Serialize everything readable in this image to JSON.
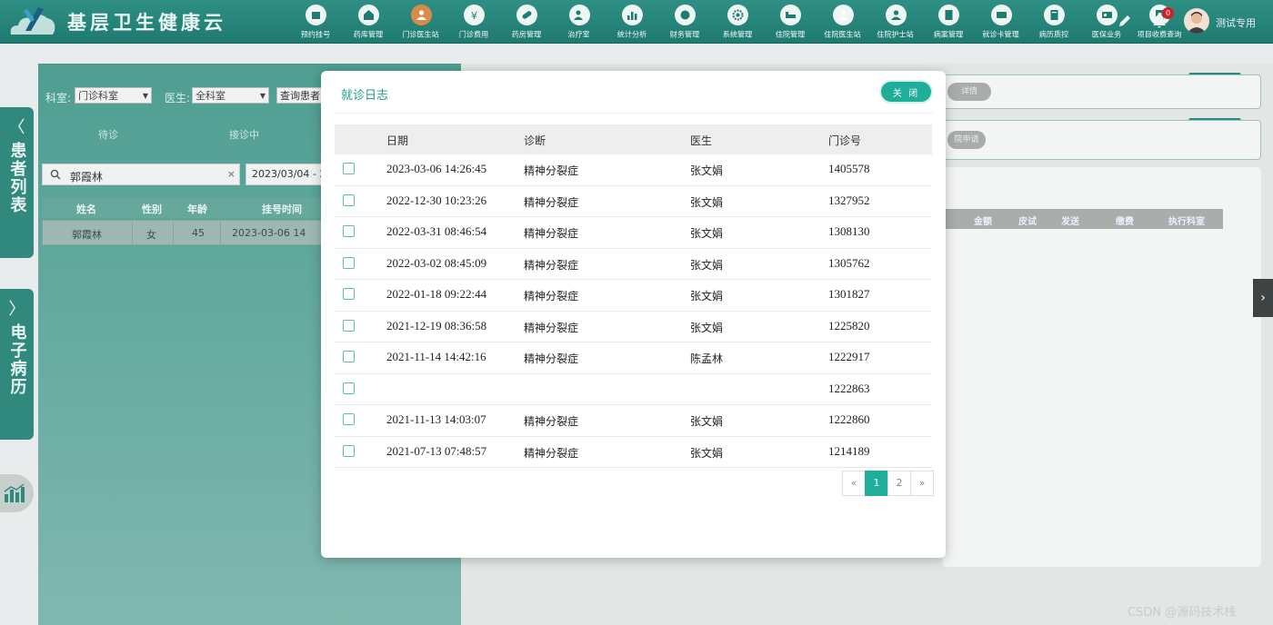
{
  "app": {
    "title": "基层卫生健康云"
  },
  "nav": [
    {
      "label": "预约挂号",
      "icon": "calendar-icon"
    },
    {
      "label": "药库管理",
      "icon": "warehouse-icon"
    },
    {
      "label": "门诊医生站",
      "icon": "doctor-icon",
      "active": true
    },
    {
      "label": "门诊费用",
      "icon": "yen-icon"
    },
    {
      "label": "药房管理",
      "icon": "pill-icon"
    },
    {
      "label": "治疗室",
      "icon": "treatment-icon"
    },
    {
      "label": "统计分析",
      "icon": "chart-icon"
    },
    {
      "label": "财务管理",
      "icon": "finance-icon"
    },
    {
      "label": "系统管理",
      "icon": "gear-icon"
    },
    {
      "label": "住院管理",
      "icon": "bed-icon"
    },
    {
      "label": "住院医生站",
      "icon": "doctor-icon"
    },
    {
      "label": "住院护士站",
      "icon": "nurse-icon"
    },
    {
      "label": "病案管理",
      "icon": "file-icon"
    },
    {
      "label": "就诊卡管理",
      "icon": "card-icon"
    },
    {
      "label": "病历质控",
      "icon": "record-icon"
    },
    {
      "label": "医保业务",
      "icon": "insurance-icon"
    },
    {
      "label": "项目收费查询",
      "icon": "search-doc-icon"
    }
  ],
  "user": {
    "name": "测试专用",
    "notifications": "0"
  },
  "filters": {
    "dept_label": "科室:",
    "dept_value": "门诊科室",
    "doctor_label": "医生:",
    "doctor_value": "全科室",
    "query_button": "查询患者"
  },
  "patient_tabs": [
    "待诊",
    "接诊中"
  ],
  "patient_search": {
    "value": "郭霞林",
    "date": "2023/03/04 - 2"
  },
  "patient_table": {
    "headers": [
      "姓名",
      "性别",
      "年龄",
      "挂号时间"
    ],
    "rows": [
      {
        "name": "郭霞林",
        "sex": "女",
        "age": "45",
        "time": "2023-03-06 14"
      }
    ]
  },
  "side_tabs": {
    "patients": "患者列表",
    "emr": "电子病历"
  },
  "right_panel": {
    "detail_button": "详情",
    "apply_button": "院申请",
    "headers": [
      "金额",
      "皮试",
      "发送",
      "缴费",
      "执行科室"
    ]
  },
  "modal": {
    "title": "就诊日志",
    "close_label": "关 闭",
    "headers": [
      "日期",
      "诊断",
      "医生",
      "门诊号"
    ],
    "rows": [
      {
        "date": "2023-03-06 14:26:45",
        "diagnosis": "精神分裂症",
        "doctor": "张文娟",
        "no": "1405578"
      },
      {
        "date": "2022-12-30 10:23:26",
        "diagnosis": "精神分裂症",
        "doctor": "张文娟",
        "no": "1327952"
      },
      {
        "date": "2022-03-31 08:46:54",
        "diagnosis": "精神分裂症",
        "doctor": "张文娟",
        "no": "1308130"
      },
      {
        "date": "2022-03-02 08:45:09",
        "diagnosis": "精神分裂症",
        "doctor": "张文娟",
        "no": "1305762"
      },
      {
        "date": "2022-01-18 09:22:44",
        "diagnosis": "精神分裂症",
        "doctor": "张文娟",
        "no": "1301827"
      },
      {
        "date": "2021-12-19 08:36:58",
        "diagnosis": "精神分裂症",
        "doctor": "张文娟",
        "no": "1225820"
      },
      {
        "date": "2021-11-14 14:42:16",
        "diagnosis": "精神分裂症",
        "doctor": "陈孟林",
        "no": "1222917"
      },
      {
        "date": "",
        "diagnosis": "",
        "doctor": "",
        "no": "1222863"
      },
      {
        "date": "2021-11-13 14:03:07",
        "diagnosis": "精神分裂症",
        "doctor": "张文娟",
        "no": "1222860"
      },
      {
        "date": "2021-07-13 07:48:57",
        "diagnosis": "精神分裂症",
        "doctor": "张文娟",
        "no": "1214189"
      }
    ],
    "pager": {
      "prev": "«",
      "pages": [
        "1",
        "2"
      ],
      "current": "1",
      "next": "»"
    }
  },
  "watermark": "CSDN @源码技术栈",
  "colors": {
    "brand": "#1f7a70",
    "accent": "#1fae9a",
    "active_nav": "#d98c4a"
  }
}
